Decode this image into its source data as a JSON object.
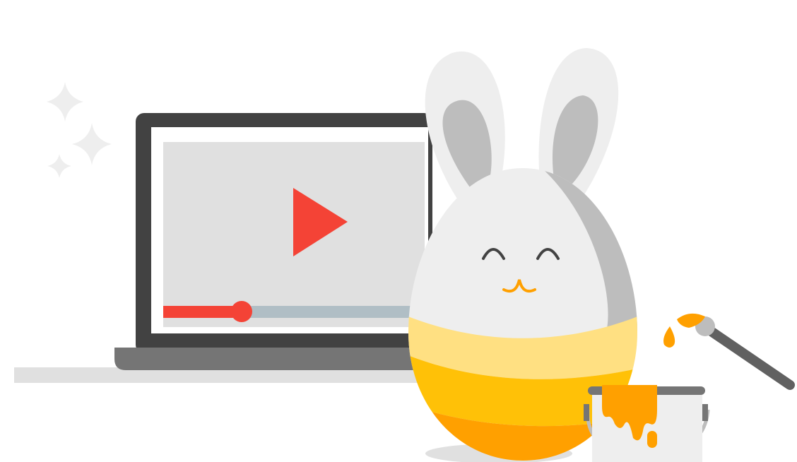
{
  "scene": {
    "background": "#ffffff",
    "illustration": "easter-bunny-egg-with-laptop-video"
  },
  "colors": {
    "laptop_frame": "#424242",
    "laptop_base": "#757575",
    "desk": "#e0e0e0",
    "screen_bg": "#e0e0e0",
    "play_button": "#f44336",
    "progress_played": "#f44336",
    "progress_remaining": "#b0bec5",
    "egg_body": "#eeeeee",
    "egg_shade": "#bdbdbd",
    "stripe_light": "#ffe082",
    "stripe_mid": "#ffc107",
    "stripe_dark": "#ffa000",
    "paint": "#ffa000",
    "sparkle": "#eeeeee"
  },
  "video": {
    "progress": 0.3
  },
  "icons": {
    "play": "play-icon",
    "sparkles": "sparkle-icon",
    "brush": "paintbrush-icon",
    "bucket": "paint-bucket-icon"
  }
}
